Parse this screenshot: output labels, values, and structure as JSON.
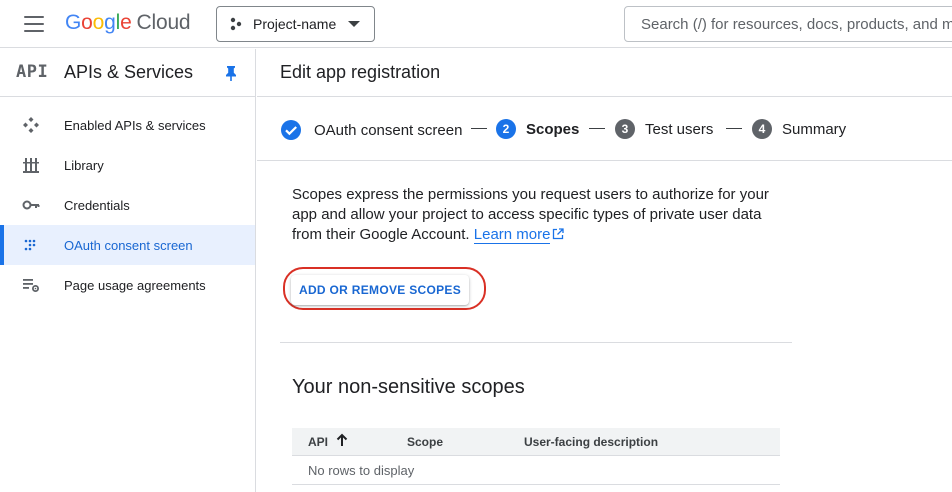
{
  "topbar": {
    "logo_letters": [
      "G",
      "o",
      "o",
      "g",
      "l",
      "e"
    ],
    "logo_suffix": "Cloud",
    "project_name": "Project-name",
    "search_placeholder": "Search (/) for resources, docs, products, and more"
  },
  "sidebar": {
    "badge": "API",
    "title": "APIs & Services",
    "items": [
      {
        "label": "Enabled APIs & services",
        "icon": "enabled-apis-icon"
      },
      {
        "label": "Library",
        "icon": "library-icon"
      },
      {
        "label": "Credentials",
        "icon": "key-icon"
      },
      {
        "label": "OAuth consent screen",
        "icon": "oauth-icon",
        "active": true
      },
      {
        "label": "Page usage agreements",
        "icon": "settings-list-icon"
      }
    ]
  },
  "main": {
    "title": "Edit app registration",
    "steps": [
      {
        "number": "",
        "label": "OAuth consent screen",
        "state": "done"
      },
      {
        "number": "2",
        "label": "Scopes",
        "state": "current"
      },
      {
        "number": "3",
        "label": "Test users",
        "state": "pending"
      },
      {
        "number": "4",
        "label": "Summary",
        "state": "pending"
      }
    ],
    "description": "Scopes express the permissions you request users to authorize for your app and allow your project to access specific types of private user data from their Google Account.",
    "learn_more": "Learn more",
    "add_scopes_button": "ADD OR REMOVE SCOPES",
    "section_title": "Your non-sensitive scopes",
    "table": {
      "columns": [
        "API",
        "Scope",
        "User-facing description"
      ],
      "empty_text": "No rows to display"
    }
  },
  "colors": {
    "accent": "#1a73e8",
    "highlight_ring": "#d93025",
    "active_nav_bg": "#e8f0fe"
  }
}
